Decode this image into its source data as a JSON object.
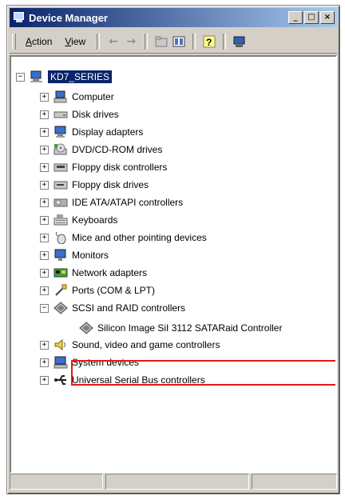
{
  "window": {
    "title": "Device Manager"
  },
  "title_buttons": [
    "_",
    "□",
    "×"
  ],
  "toolbar": {
    "menus": [
      {
        "label": "Action",
        "accel": "A",
        "rest": "ction"
      },
      {
        "label": "View",
        "accel": "V",
        "rest": "iew"
      }
    ]
  },
  "tree": {
    "root": "KD7_SERIES",
    "items": [
      {
        "label": "Computer",
        "icon": "computer-icon"
      },
      {
        "label": "Disk drives",
        "icon": "disk-drive-icon"
      },
      {
        "label": "Display adapters",
        "icon": "display-adapter-icon"
      },
      {
        "label": "DVD/CD-ROM drives",
        "icon": "dvd-drive-icon"
      },
      {
        "label": "Floppy disk controllers",
        "icon": "floppy-controller-icon"
      },
      {
        "label": "Floppy disk drives",
        "icon": "floppy-drive-icon"
      },
      {
        "label": "IDE ATA/ATAPI controllers",
        "icon": "ide-controller-icon"
      },
      {
        "label": "Keyboards",
        "icon": "keyboard-icon"
      },
      {
        "label": "Mice and other pointing devices",
        "icon": "mouse-icon"
      },
      {
        "label": "Monitors",
        "icon": "monitor-icon"
      },
      {
        "label": "Network adapters",
        "icon": "network-adapter-icon"
      },
      {
        "label": "Ports (COM & LPT)",
        "icon": "port-icon"
      },
      {
        "label": "SCSI and RAID controllers",
        "icon": "scsi-controller-icon",
        "expanded": true
      },
      {
        "label": "Sound, video and game controllers",
        "icon": "sound-icon"
      },
      {
        "label": "System devices",
        "icon": "system-devices-icon"
      },
      {
        "label": "Universal Serial Bus controllers",
        "icon": "usb-icon"
      }
    ],
    "child": "Silicon Image SiI 3112 SATARaid Controller"
  },
  "colors": {
    "highlight": "#e31818",
    "selection": "#0a246a"
  }
}
